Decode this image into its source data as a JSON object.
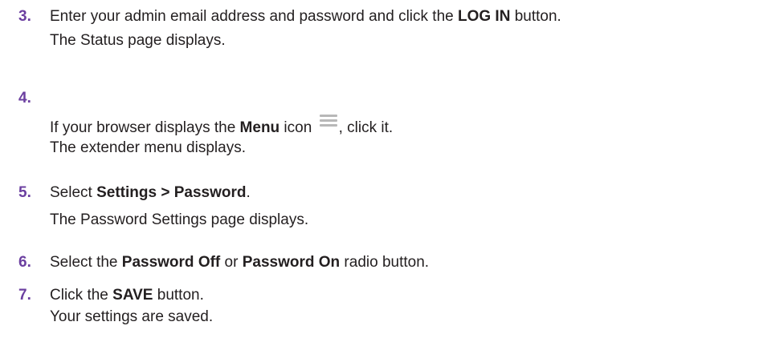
{
  "accent_color": "#6b3fa0",
  "steps": [
    {
      "number": "3.",
      "instruction_before": "Enter your admin email address and password and click the ",
      "instruction_bold": "LOG IN",
      "instruction_after": " button.",
      "result": "The Status page displays."
    },
    {
      "number": "4.",
      "instruction_before": "If your browser displays the ",
      "instruction_bold": "Menu",
      "instruction_mid": " icon ",
      "icon": "menu-icon",
      "instruction_after": ", click it.",
      "result": "The extender menu displays."
    },
    {
      "number": "5.",
      "instruction_before": "Select ",
      "instruction_bold": "Settings > Password",
      "instruction_after": ".",
      "result": "The Password Settings page displays."
    },
    {
      "number": "6.",
      "instruction_before": "Select the ",
      "instruction_bold": "Password Off",
      "instruction_mid": " or ",
      "instruction_bold_2": "Password On",
      "instruction_after": " radio button."
    },
    {
      "number": "7.",
      "instruction_before": "Click the ",
      "instruction_bold": "SAVE",
      "instruction_after": " button.",
      "result": "Your settings are saved."
    }
  ]
}
